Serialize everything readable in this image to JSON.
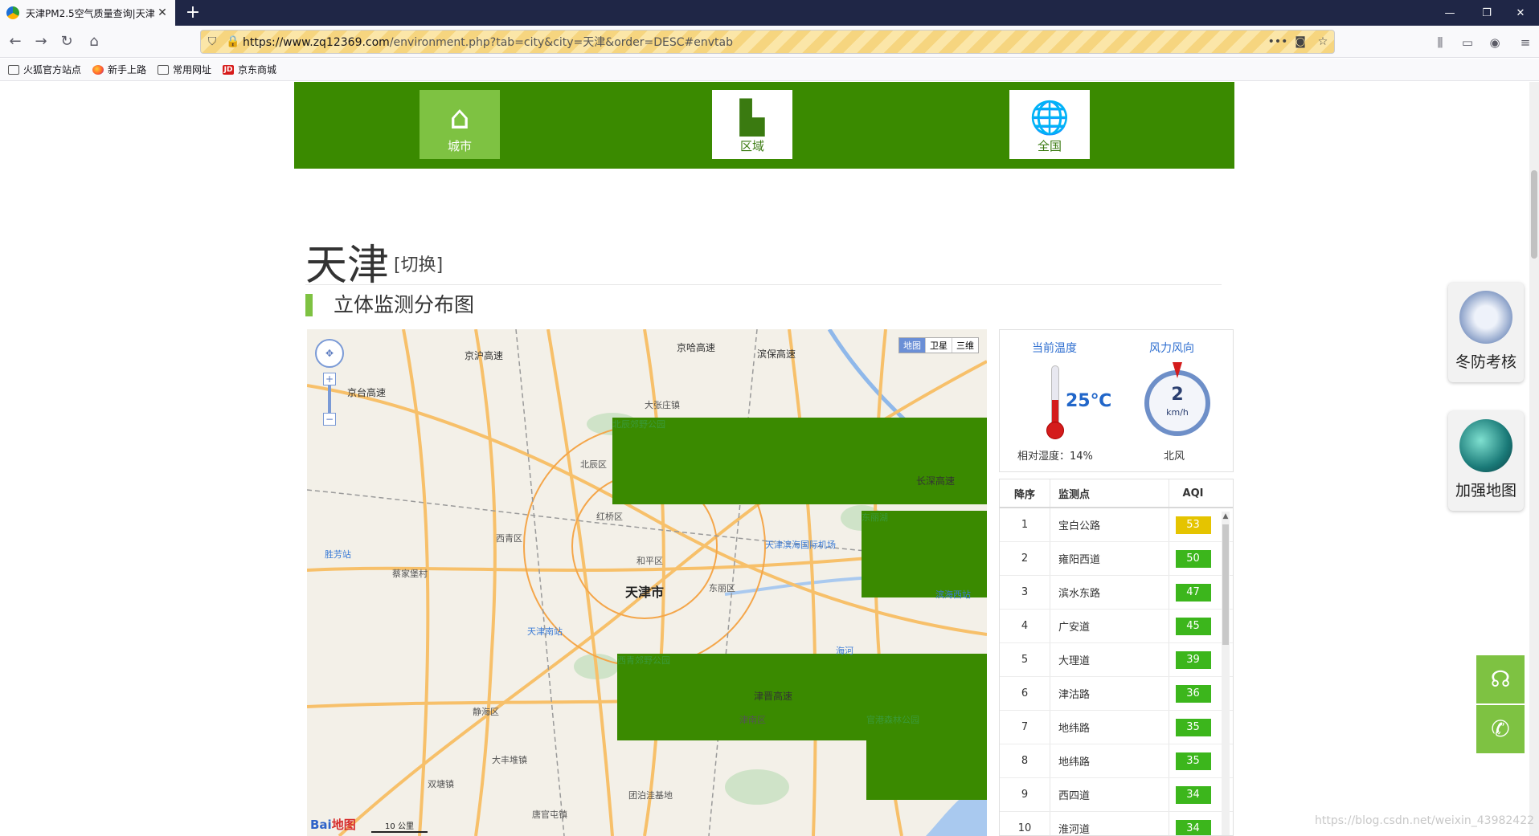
{
  "browser": {
    "tab_title": "天津PM2.5空气质量查询|天津",
    "url_domain": "https://www.zq12369.com",
    "url_path": "/environment.php?tab=city&city=天津&order=DESC#envtab",
    "bookmarks": [
      "火狐官方站点",
      "新手上路",
      "常用网址",
      "京东商城"
    ]
  },
  "nav_tiles": [
    {
      "label": "城市",
      "active": true
    },
    {
      "label": "区域",
      "active": false
    },
    {
      "label": "全国",
      "active": false
    }
  ],
  "header": {
    "city": "天津",
    "switch_label": "[切换]"
  },
  "section_title": "立体监测分布图",
  "map": {
    "type_buttons": [
      "地图",
      "卫星",
      "三维"
    ],
    "active_type": "地图",
    "center_label": "天津市",
    "labels": [
      "京沪高速",
      "京哈高速",
      "滨保高速",
      "京台高速",
      "北辰郊野公园",
      "大张庄镇",
      "北辰区",
      "红桥区",
      "西青区",
      "和平区",
      "东丽区",
      "天津滨海国际机场",
      "东丽湖",
      "天津南站",
      "西青郊野公园",
      "静海区",
      "津晋高速",
      "津南区",
      "官港森林公园",
      "海河",
      "胜芳站",
      "滨海西站",
      "长深高速",
      "蔡家堡村",
      "大丰堆镇",
      "双塘镇",
      "团泊洼基地",
      "唐官屯镇"
    ],
    "scale": "10 公里",
    "logo": "Bai",
    "logo_suffix": "地图"
  },
  "weather": {
    "temp_label": "当前温度",
    "temperature": "25℃",
    "humidity": "相对湿度：14%",
    "wind_label": "风力风向",
    "wind_speed": "2",
    "wind_unit": "km/h",
    "wind_dir": "北风"
  },
  "ranking": {
    "headers": [
      "降序",
      "监测点",
      "AQI"
    ],
    "rows": [
      {
        "rank": "1",
        "site": "宝白公路",
        "aqi": "53",
        "color": "#e5c400"
      },
      {
        "rank": "2",
        "site": "雍阳西道",
        "aqi": "50",
        "color": "#3cb61c"
      },
      {
        "rank": "3",
        "site": "滨水东路",
        "aqi": "47",
        "color": "#3cb61c"
      },
      {
        "rank": "4",
        "site": "广安道",
        "aqi": "45",
        "color": "#3cb61c"
      },
      {
        "rank": "5",
        "site": "大理道",
        "aqi": "39",
        "color": "#3cb61c"
      },
      {
        "rank": "6",
        "site": "津沽路",
        "aqi": "36",
        "color": "#3cb61c"
      },
      {
        "rank": "7",
        "site": "地纬路",
        "aqi": "35",
        "color": "#3cb61c"
      },
      {
        "rank": "8",
        "site": "地纬路",
        "aqi": "35",
        "color": "#3cb61c"
      },
      {
        "rank": "9",
        "site": "西四道",
        "aqi": "34",
        "color": "#3cb61c"
      },
      {
        "rank": "10",
        "site": "淮河道",
        "aqi": "34",
        "color": "#3cb61c"
      }
    ]
  },
  "float_widgets": [
    {
      "label": "冬防考核"
    },
    {
      "label": "加强地图"
    }
  ],
  "watermark": "https://blog.csdn.net/weixin_43982422"
}
